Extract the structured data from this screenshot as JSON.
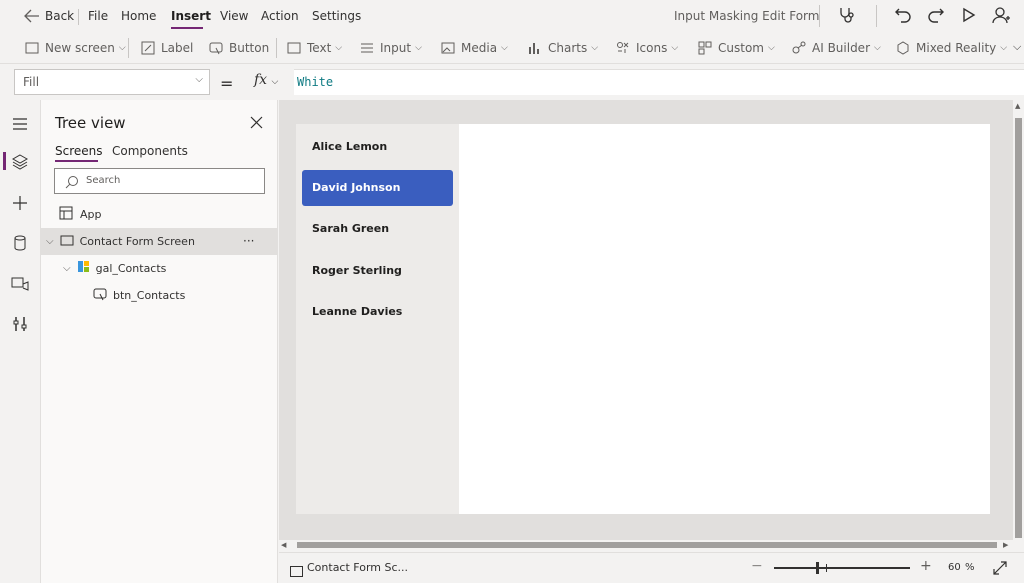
{
  "topbar": {
    "back_label": "Back",
    "menu": [
      "File",
      "Home",
      "Insert",
      "View",
      "Action",
      "Settings"
    ],
    "app_title": "Input Masking Edit Form"
  },
  "toolbar": {
    "new_screen": "New screen",
    "label": "Label",
    "button": "Button",
    "text": "Text",
    "input": "Input",
    "media": "Media",
    "charts": "Charts",
    "icons": "Icons",
    "custom": "Custom",
    "ai_builder": "AI Builder",
    "mixed_reality": "Mixed Reality"
  },
  "formula": {
    "property": "Fill",
    "equals": "=",
    "fx": "fx",
    "value": "White"
  },
  "tree": {
    "title": "Tree view",
    "tabs": [
      "Screens",
      "Components"
    ],
    "search_placeholder": "Search",
    "app_label": "App",
    "screen_label": "Contact Form Screen",
    "screen_more": "···",
    "gallery_label": "gal_Contacts",
    "button_label": "btn_Contacts"
  },
  "gallery": {
    "items": [
      "Alice Lemon",
      "David Johnson",
      "Sarah Green",
      "Roger Sterling",
      "Leanne Davies"
    ],
    "selected_index": 1
  },
  "status": {
    "screen_name": "Contact Form Sc...",
    "zoom_minus": "−",
    "zoom_plus": "+",
    "zoom_value": "60",
    "zoom_unit": "%"
  },
  "colors": {
    "accent": "#742774",
    "selected": "#3a5ebf",
    "formula_text": "#0f7b83"
  }
}
